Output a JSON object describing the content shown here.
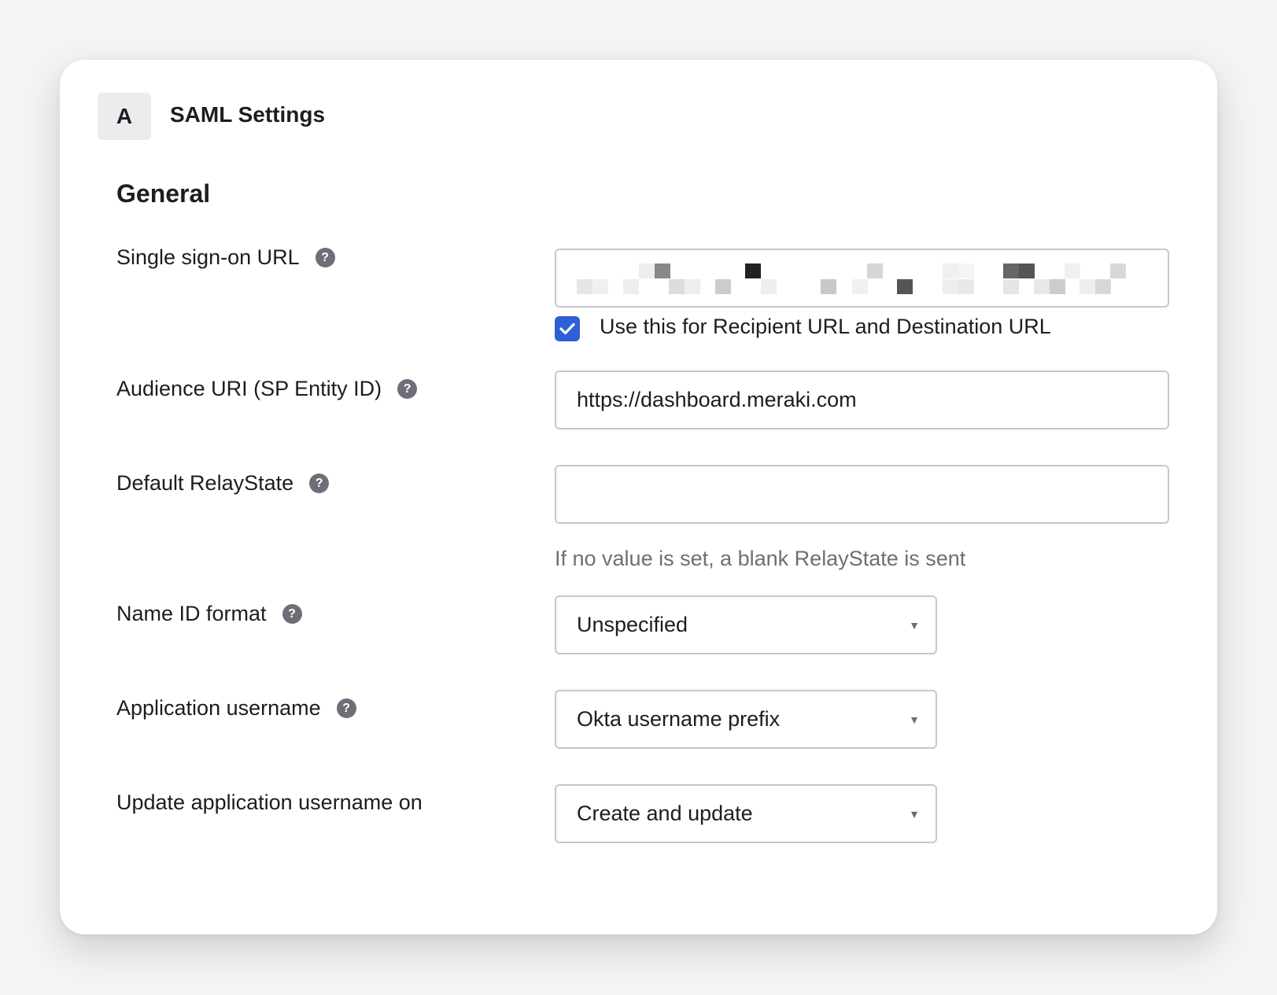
{
  "card": {
    "badge": "A",
    "title": "SAML Settings"
  },
  "section": {
    "title": "General"
  },
  "fields": {
    "sso_url": {
      "label": "Single sign-on URL",
      "checkbox_label": "Use this for Recipient URL and Destination URL",
      "checkbox_checked": true
    },
    "audience_uri": {
      "label": "Audience URI (SP Entity ID)",
      "value": "https://dashboard.meraki.com"
    },
    "relay_state": {
      "label": "Default RelayState",
      "value": "",
      "hint": "If no value is set, a blank RelayState is sent"
    },
    "name_id_format": {
      "label": "Name ID format",
      "selected": "Unspecified"
    },
    "app_username": {
      "label": "Application username",
      "selected": "Okta username prefix"
    },
    "update_username_on": {
      "label": "Update application username on",
      "selected": "Create and update"
    }
  },
  "icons": {
    "help": "question-circle-icon",
    "check": "checkmark-icon",
    "caret": "caret-down-icon"
  },
  "colors": {
    "accent": "#2f5fd6",
    "help_icon": "#6e6e78",
    "hint_text": "#6e6e78",
    "border": "#c7c7cc"
  }
}
